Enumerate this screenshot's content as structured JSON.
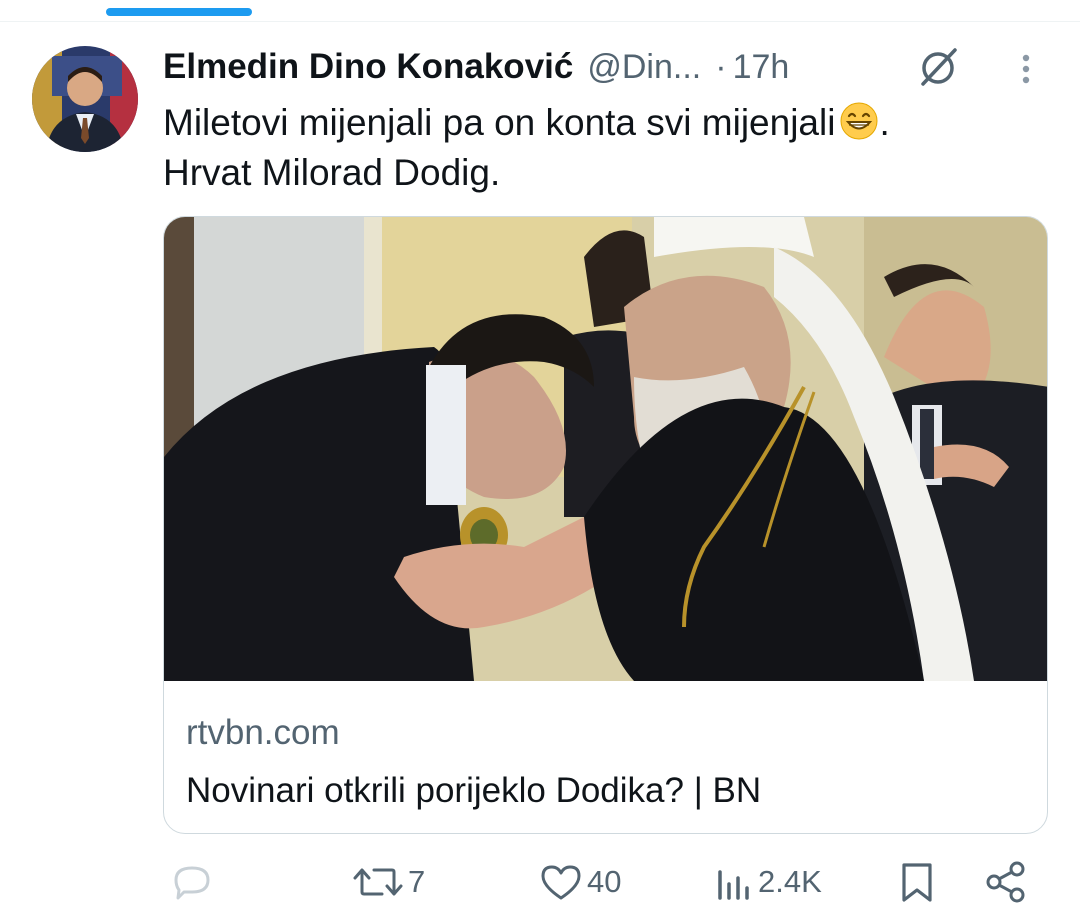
{
  "author": {
    "name": "Elmedin Dino Konaković",
    "handle": "@Din...",
    "separator": "·",
    "time": "17h"
  },
  "tweet": {
    "line1": "Miletovi mijenjali pa on konta svi mijenjali",
    "line1_end": ".",
    "line2": "Hrvat Milorad Dodig."
  },
  "card": {
    "domain": "rtvbn.com",
    "title": "Novinari otkrili porijeklo Dodika? | BN"
  },
  "actions": {
    "replies": "",
    "retweets": "7",
    "likes": "40",
    "views": "2.4K"
  },
  "icons": {
    "grok": "grok-icon",
    "more": "more-vertical-icon",
    "reply": "reply-icon",
    "retweet": "retweet-icon",
    "like": "heart-icon",
    "views": "views-icon",
    "bookmark": "bookmark-icon",
    "share": "share-icon"
  },
  "colors": {
    "accent": "#1d9bf0",
    "secondary_text": "#536471",
    "primary_text": "#0f1419",
    "border": "#cfd9de"
  }
}
